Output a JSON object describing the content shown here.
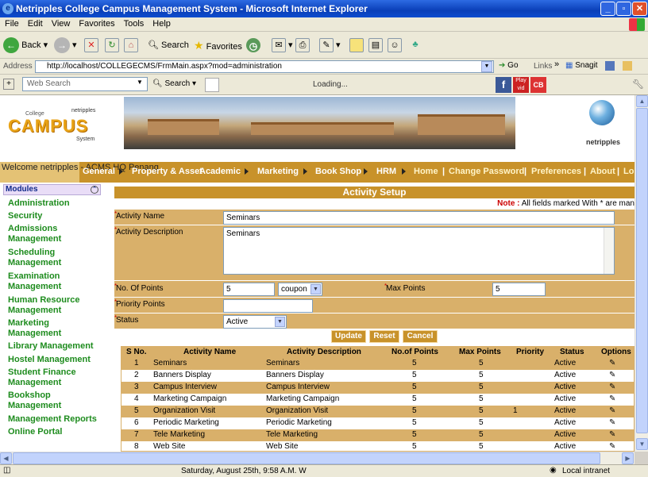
{
  "window": {
    "title": "Netripples College Campus Management System - Microsoft Internet Explorer"
  },
  "menu": [
    "File",
    "Edit",
    "View",
    "Favorites",
    "Tools",
    "Help"
  ],
  "toolbar": {
    "back": "Back",
    "search": "Search",
    "favorites": "Favorites"
  },
  "address": {
    "label": "Address",
    "url": "http://localhost/COLLEGECMS/FrmMain.aspx?mod=administration",
    "go": "Go",
    "links": "Links",
    "snagit": "Snagit"
  },
  "searchbar": {
    "placeholder": "Web Search",
    "search": "Search",
    "loading": "Loading..."
  },
  "banner": {
    "college": "College",
    "campus": "CAMPUS",
    "system": "System",
    "netripples_small": "netripples",
    "netripples": "netripples"
  },
  "nav": {
    "welcome": "Welcome netripples - ACMS HQ Penang",
    "items": [
      "General",
      "Property & Asset",
      "Academic",
      "Marketing",
      "Book Shop",
      "HRM"
    ],
    "links": [
      "Home",
      "Change Password",
      "Preferences",
      "About",
      "Lo"
    ]
  },
  "sidebar": {
    "header": "Modules",
    "items": [
      "Administration",
      "Security",
      "Admissions Management",
      "Scheduling Management",
      "Examination Management",
      "Human Resource Management",
      "Marketing Management",
      "Library Management",
      "Hostel Management",
      "Student Finance Management",
      "Bookshop Management",
      "Management Reports",
      "Online Portal"
    ]
  },
  "form": {
    "title": "Activity Setup",
    "note_label": "Note :",
    "note_text": " All fields marked With * are man",
    "activity_name_label": "Activity Name",
    "activity_name": "Seminars",
    "activity_desc_label": "Activity Description",
    "activity_desc": "Seminars",
    "points_label": "No. Of Points",
    "points": "5",
    "points_unit": "coupon",
    "max_points_label": "Max Points",
    "max_points": "5",
    "priority_label": "Priority Points",
    "priority": "",
    "status_label": "Status",
    "status": "Active",
    "update": "Update",
    "reset": "Reset",
    "cancel": "Cancel"
  },
  "table": {
    "columns": [
      "S No.",
      "Activity Name",
      "Activity Description",
      "No.of Points",
      "Max Points",
      "Priority",
      "Status",
      "Options"
    ],
    "rows": [
      [
        "1",
        "Seminars",
        "Seminars",
        "5",
        "5",
        "",
        "Active"
      ],
      [
        "2",
        "Banners Display",
        "Banners Display",
        "5",
        "5",
        "",
        "Active"
      ],
      [
        "3",
        "Campus Interview",
        "Campus Interview",
        "5",
        "5",
        "",
        "Active"
      ],
      [
        "4",
        "Marketing Campaign",
        "Marketing Campaign",
        "5",
        "5",
        "",
        "Active"
      ],
      [
        "5",
        "Organization Visit",
        "Organization Visit",
        "5",
        "5",
        "1",
        "Active"
      ],
      [
        "6",
        "Periodic Marketing",
        "Periodic Marketing",
        "5",
        "5",
        "",
        "Active"
      ],
      [
        "7",
        "Tele Marketing",
        "Tele Marketing",
        "5",
        "5",
        "",
        "Active"
      ],
      [
        "8",
        "Web Site",
        "Web Site",
        "5",
        "5",
        "",
        "Active"
      ]
    ]
  },
  "status": {
    "text": "Saturday, August 25th, 9:58 A.M.  W",
    "zone": "Local intranet"
  }
}
